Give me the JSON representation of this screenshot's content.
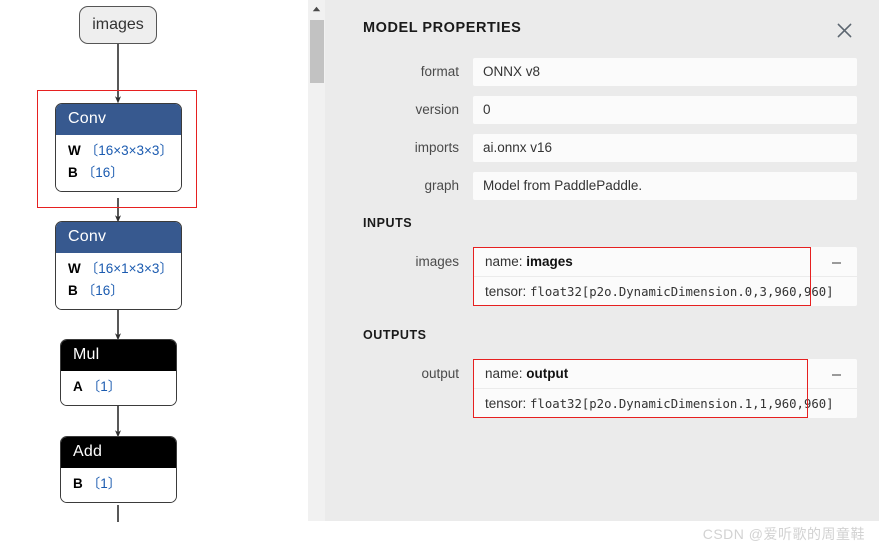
{
  "graph": {
    "input_node": {
      "label": "images"
    },
    "nodes": [
      {
        "id": "conv1",
        "type": "Conv",
        "header_color": "#37598f",
        "attrs": [
          {
            "key": "W",
            "value": "〔16×3×3×3〕"
          },
          {
            "key": "B",
            "value": "〔16〕"
          }
        ]
      },
      {
        "id": "conv2",
        "type": "Conv",
        "header_color": "#37598f",
        "attrs": [
          {
            "key": "W",
            "value": "〔16×1×3×3〕"
          },
          {
            "key": "B",
            "value": "〔16〕"
          }
        ]
      },
      {
        "id": "mul",
        "type": "Mul",
        "header_color": "#000000",
        "attrs": [
          {
            "key": "A",
            "value": "〔1〕"
          }
        ]
      },
      {
        "id": "add",
        "type": "Add",
        "header_color": "#000000",
        "attrs": [
          {
            "key": "B",
            "value": "〔1〕"
          }
        ]
      }
    ],
    "highlight_color": "#e62020"
  },
  "panel": {
    "title": "MODEL PROPERTIES",
    "close_icon": "close-icon",
    "properties": [
      {
        "label": "format",
        "value": "ONNX v8"
      },
      {
        "label": "version",
        "value": "0"
      },
      {
        "label": "imports",
        "value": "ai.onnx v16"
      },
      {
        "label": "graph",
        "value": "Model from PaddlePaddle."
      }
    ],
    "inputs_heading": "INPUTS",
    "inputs": [
      {
        "label": "images",
        "name_prefix": "name: ",
        "name": "images",
        "tensor_prefix": "tensor: ",
        "tensor": "float32[p2o.DynamicDimension.0,3,960,960]",
        "collapse_icon": "minus-icon"
      }
    ],
    "outputs_heading": "OUTPUTS",
    "outputs": [
      {
        "label": "output",
        "name_prefix": "name: ",
        "name": "output",
        "tensor_prefix": "tensor: ",
        "tensor": "float32[p2o.DynamicDimension.1,1,960,960]",
        "collapse_icon": "minus-icon"
      }
    ],
    "scrollbar": {
      "up_arrow_icon": "chevron-up-icon"
    }
  },
  "watermark": {
    "text": "CSDN @爱听歌的周童鞋"
  }
}
